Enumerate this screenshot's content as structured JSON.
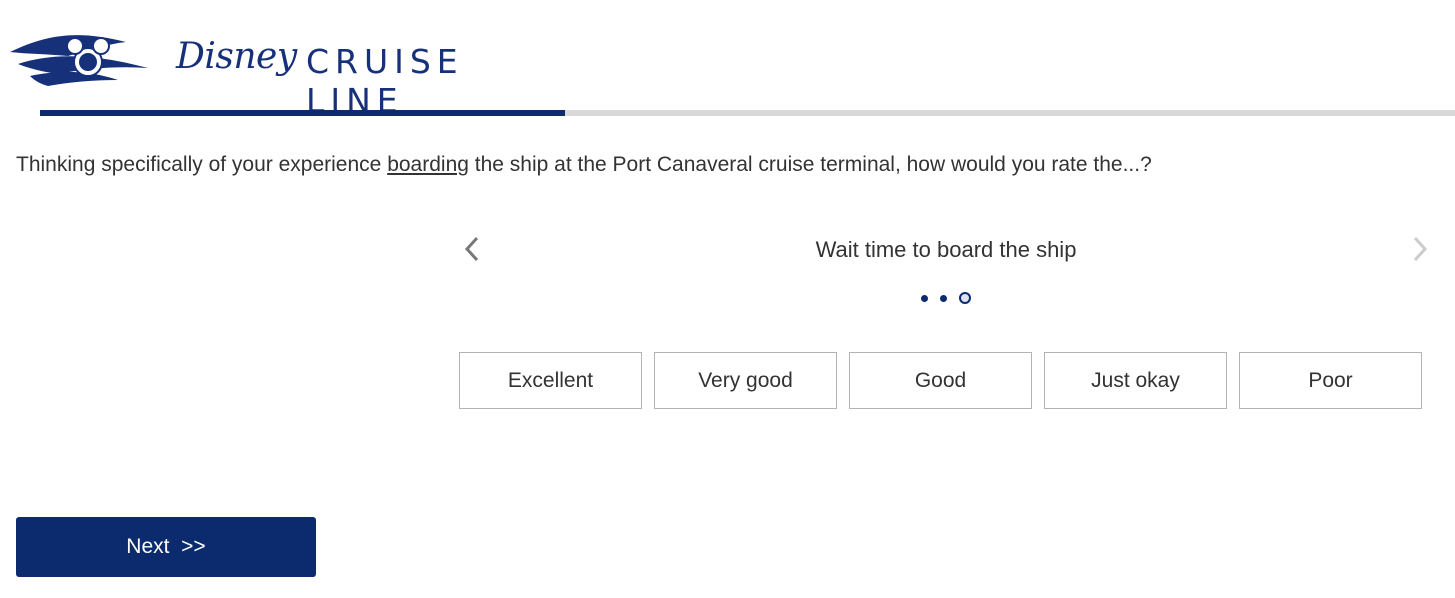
{
  "brand": {
    "disney": "Disney",
    "line": "CRUISE LINE",
    "color": "#16307a"
  },
  "progress": {
    "fraction": 0.371,
    "fill_color": "#0c2a6e",
    "track_color": "#d9d9d9"
  },
  "question": {
    "before": "Thinking specifically of your experience ",
    "emphasis": "boarding",
    "after": " the ship at the Port Canaveral cruise terminal, how would you rate the...?"
  },
  "carousel": {
    "item_label": "Wait time to board the ship",
    "prev_icon": "chevron-left-icon",
    "next_icon": "chevron-right-icon",
    "total_items": 3,
    "active_index": 2
  },
  "options": [
    "Excellent",
    "Very good",
    "Good",
    "Just okay",
    "Poor"
  ],
  "next_button": {
    "label": "Next  >>",
    "color": "#0c2a6e"
  }
}
